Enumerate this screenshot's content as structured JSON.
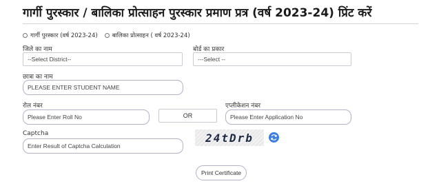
{
  "page": {
    "title": "गार्गी पुरस्कार / बालिका प्रोत्साहन पुरस्कार प्रमाण प्रत्र (वर्ष 2023-24) प्रिंट करें"
  },
  "scheme_options": [
    {
      "label": "गार्गी पुरस्कार (वर्ष 2023-24)"
    },
    {
      "label": "बालिका प्रोत्साहन ( वर्ष 2023-24)"
    }
  ],
  "district": {
    "label": "जिले का नाम",
    "selected": "--Select District--"
  },
  "board": {
    "label": "बोर्ड का प्रकार",
    "selected": "---Select --"
  },
  "student": {
    "label": "छात्रा का नाम",
    "placeholder": "PLEASE ENTER STUDENT NAME"
  },
  "roll": {
    "label": "रोल नंबर",
    "placeholder": "Please Enter Roll No"
  },
  "or_label": "OR",
  "application": {
    "label": "एप्लीकेशन नंबर",
    "placeholder": "Please Enter Application No"
  },
  "captcha": {
    "label": "Captcha",
    "placeholder": "Enter Result of Captcha Calculation",
    "image_text": "24tDrb",
    "refresh_icon": "refresh-icon"
  },
  "print_button": "Print Certificate",
  "colors": {
    "accent_border": "#b9aec8",
    "refresh_blue": "#3b7de0"
  }
}
